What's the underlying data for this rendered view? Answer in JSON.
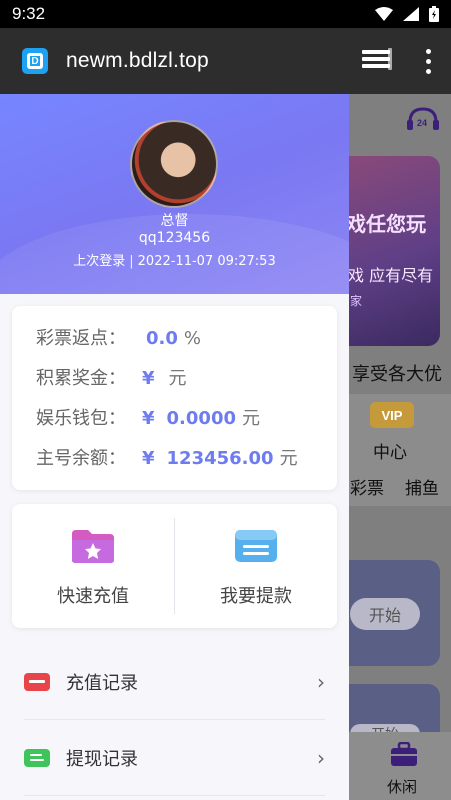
{
  "status_bar": {
    "time": "9:32"
  },
  "browser": {
    "url": "newm.bdlzl.top"
  },
  "background_page": {
    "banner_line1": "戏任您玩",
    "banner_line2": "戏 应有尽有",
    "banner_line3": "家",
    "promo_text": "享受各大优",
    "vip_label": "VIP",
    "center_label": "中心",
    "lottery_label": "彩票",
    "fishing_label": "捕鱼",
    "start_label": "开始",
    "start_label_2": "开始",
    "tab_leisure_label": "休闲"
  },
  "profile": {
    "nickname": "总督",
    "account": "qq123456",
    "last_login_label": "上次登录",
    "last_login_separator": "|",
    "last_login_time": "2022-11-07 09:27:53"
  },
  "stats": {
    "rebate_label": "彩票返点：",
    "rebate_value": "0.0",
    "rebate_unit": "%",
    "bonus_label": "积累奖金：",
    "bonus_currency": "¥",
    "bonus_unit": "元",
    "wallet_label": "娱乐钱包：",
    "wallet_currency": "¥",
    "wallet_value": "0.0000",
    "wallet_unit": "元",
    "balance_label": "主号余额：",
    "balance_currency": "¥",
    "balance_value": "123456.00",
    "balance_unit": "元"
  },
  "actions": {
    "deposit_label": "快速充值",
    "withdraw_label": "我要提款"
  },
  "menu": {
    "items": [
      {
        "label": "充值记录",
        "icon": "card-icon",
        "color": "#e8454a"
      },
      {
        "label": "提现记录",
        "icon": "document-icon",
        "color": "#3ec45a"
      }
    ]
  },
  "colors": {
    "accent": "#6e7cf0",
    "header_gradient_start": "#7686ff",
    "header_gradient_end": "#8e87f4"
  }
}
